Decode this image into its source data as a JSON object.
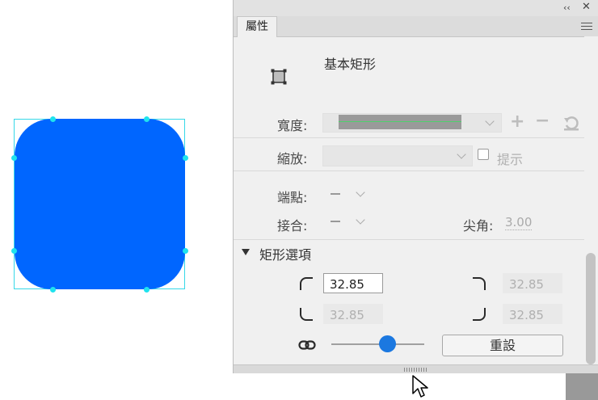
{
  "colors": {
    "shape_fill": "#0066ff",
    "selection": "#1fe3ee",
    "slider_knob": "#1b78e0"
  },
  "titlebar": {
    "collapse_icon": "double-chevron-left-icon",
    "close_icon": "close-icon"
  },
  "panel": {
    "tab_label": "屬性",
    "tool_name": "基本矩形",
    "stroke": {
      "width_label": "寬度:"
    },
    "scale": {
      "label": "縮放:",
      "hint_label": "提示",
      "hint_checked": false
    },
    "cap": {
      "label": "端點:"
    },
    "join": {
      "label": "接合:",
      "miter_label": "尖角:",
      "miter_value": "3.00"
    },
    "rect_options": {
      "section_label": "矩形選項",
      "corner_top_left": "32.85",
      "corner_top_right": "32.85",
      "corner_bottom_left": "32.85",
      "corner_bottom_right": "32.85",
      "slider_value": 0.6,
      "reset_label": "重設"
    }
  }
}
